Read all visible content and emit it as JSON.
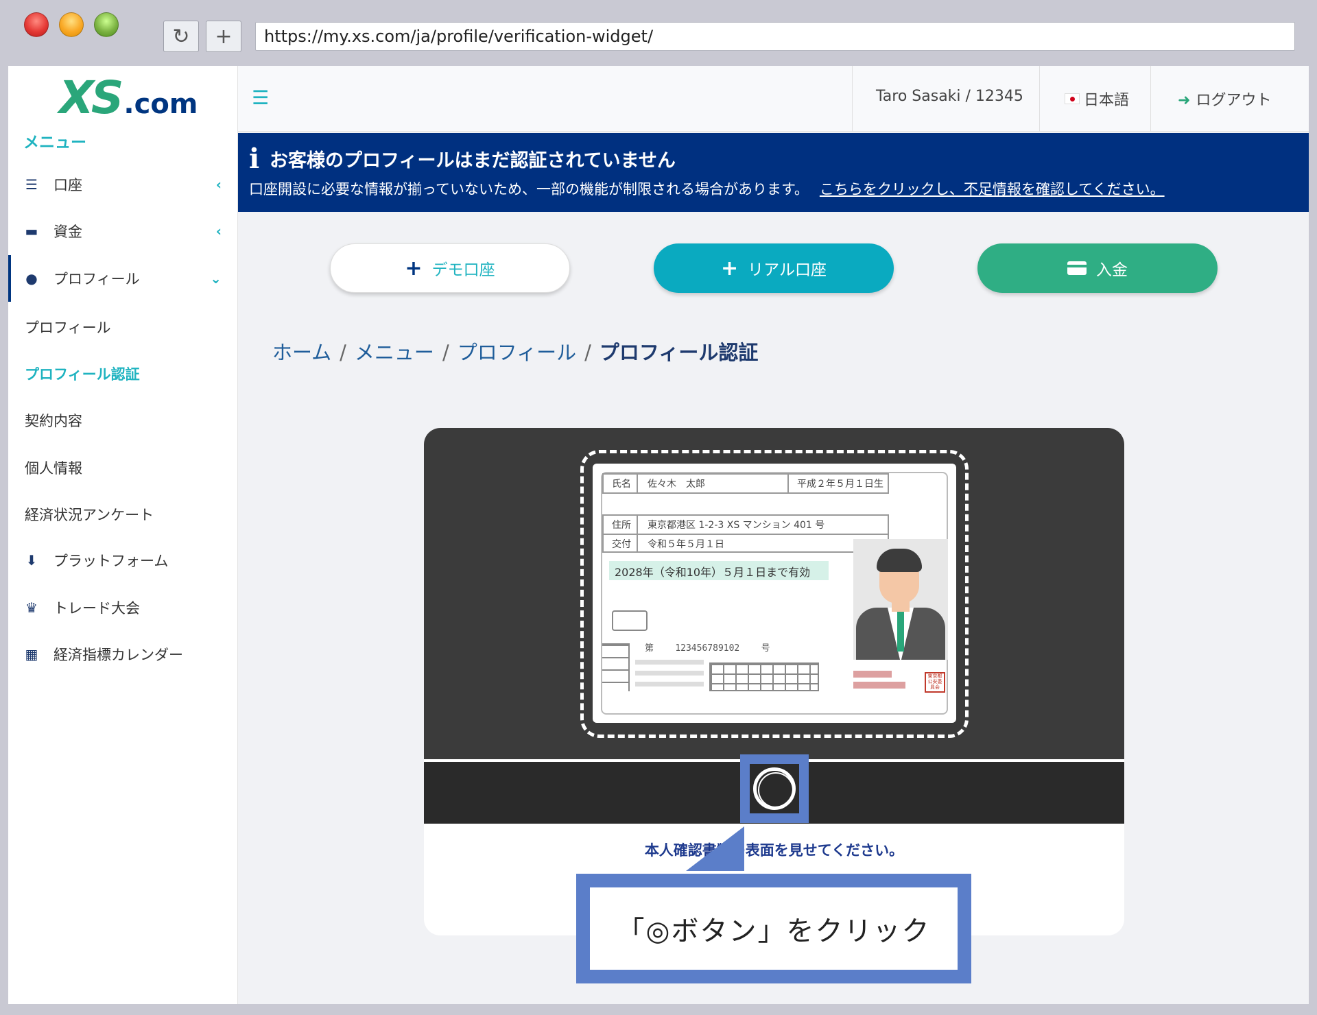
{
  "browser": {
    "url": "https://my.xs.com/ja/profile/verification-widget/",
    "reload_icon": "↻",
    "newtab_icon": "+"
  },
  "sidebar": {
    "logo_xs": "XS",
    "logo_com": ".com",
    "menu_heading": "メニュー",
    "items": [
      {
        "label": "口座",
        "icon": "list-icon"
      },
      {
        "label": "資金",
        "icon": "wallet-icon"
      },
      {
        "label": "プロフィール",
        "icon": "user-icon"
      },
      {
        "label": "プラットフォーム",
        "icon": "download-icon"
      },
      {
        "label": "トレード大会",
        "icon": "trophy-icon"
      },
      {
        "label": "経済指標カレンダー",
        "icon": "calendar-icon"
      }
    ],
    "sub_items": [
      "プロフィール",
      "プロフィール認証",
      "契約内容",
      "個人情報",
      "経済状況アンケート"
    ]
  },
  "topbar": {
    "user": "Taro Sasaki / 12345",
    "language": "日本語",
    "logout": "ログアウト"
  },
  "alert": {
    "title": "お客様のプロフィールはまだ認証されていません",
    "text": "口座開設に必要な情報が揃っていないため、一部の機能が制限される場合があります。",
    "link": "こちらをクリックし、不足情報を確認してください。"
  },
  "actions": {
    "demo": "デモ口座",
    "real": "リアル口座",
    "deposit": "入金"
  },
  "breadcrumb": [
    "ホーム",
    "メニュー",
    "プロフィール",
    "プロフィール認証"
  ],
  "idcard": {
    "name_label": "氏名",
    "name": "佐々木　太郎",
    "birth": "平成２年５月１日生",
    "address_label": "住所",
    "address": "東京都港区 1-2-3 XS マンション 401 号",
    "issue_label": "交付",
    "issue": "令和５年５月１日",
    "validity": "2028年（令和10年）５月１日まで有効",
    "number_prefix": "第",
    "number": "123456789102",
    "number_suffix": "号",
    "stamp": "東京都公安委員会"
  },
  "widget": {
    "instruction": "本人確認書類の表面を見せてください。"
  },
  "callout": {
    "text": "「◎ボタン」をクリック"
  }
}
